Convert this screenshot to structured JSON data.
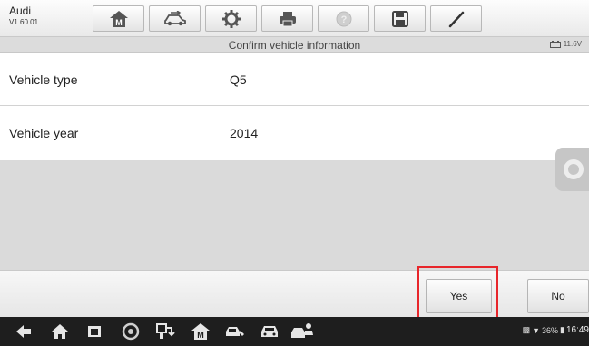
{
  "app": {
    "name": "Audi",
    "version": "V1.60.01"
  },
  "toolbar": {
    "buttons": [
      {
        "icon": "home-m-icon"
      },
      {
        "icon": "vehicle-swap-icon"
      },
      {
        "icon": "settings-gear-icon"
      },
      {
        "icon": "printer-icon"
      },
      {
        "icon": "help-icon",
        "disabled": true
      },
      {
        "icon": "save-icon"
      },
      {
        "icon": "edit-pen-icon"
      }
    ]
  },
  "title_bar": {
    "title": "Confirm vehicle information",
    "voltage": "11.6V"
  },
  "vehicle_info": {
    "rows": [
      {
        "label": "Vehicle type",
        "value": "Q5"
      },
      {
        "label": "Vehicle year",
        "value": "2014"
      }
    ]
  },
  "actions": {
    "yes_label": "Yes",
    "no_label": "No"
  },
  "status": {
    "battery": "36%",
    "time": "16:49"
  },
  "colors": {
    "highlight": "#e8262b",
    "navbar": "#1e1e1e",
    "title_bar": "#dcdcdc",
    "empty_area": "#dadada"
  }
}
